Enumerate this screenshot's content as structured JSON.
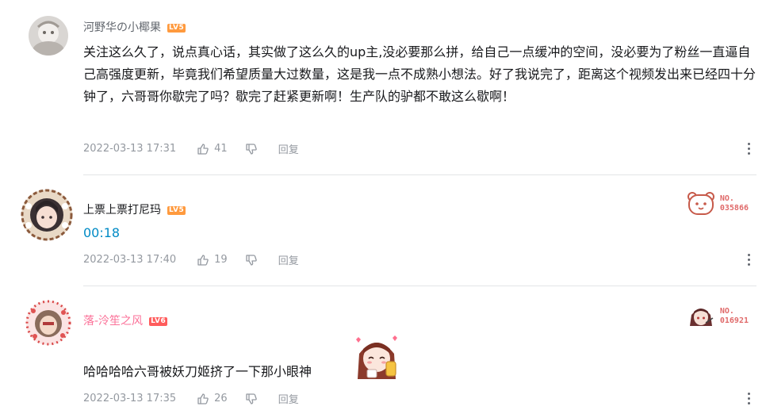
{
  "comments": [
    {
      "username": "河野华の小椰果",
      "level": "LV5",
      "content": "关注这么久了，说点真心话，其实做了这么久的up主,没必要那么拼，给自己一点缓冲的空间，没必要为了粉丝一直逼自己高强度更新，毕竟我们希望质量大过数量，这是我一点不成熟小想法。好了我说完了，距离这个视频发出来已经四十分钟了，六哥哥你歇完了吗？歇完了赶紧更新啊！生产队的驴都不敢这么歇啊！",
      "date": "2022-03-13 17:31",
      "likes": "41",
      "reply_label": "回复"
    },
    {
      "username": "上票上票打尼玛",
      "level": "LV5",
      "content": "00:18",
      "date": "2022-03-13 17:40",
      "likes": "19",
      "reply_label": "回复",
      "badge_label": "NO.",
      "badge_number": "035866"
    },
    {
      "username": "落-泠笙之风",
      "level": "LV6",
      "content": "哈哈哈哈六哥被妖刀姬挤了一下那小眼神",
      "date": "2022-03-13 17:35",
      "likes": "26",
      "reply_label": "回复",
      "badge_label": "NO.",
      "badge_number": "016921"
    }
  ],
  "colors": {
    "username_gray": "#61666d",
    "username_pink": "#fb7299",
    "timestamp_link": "#008ac5",
    "meta_gray": "#9499a0",
    "level_orange": "#ff9a3e",
    "level_red": "#ff5c5c"
  },
  "icons": {
    "like": "thumbs-up-icon",
    "dislike": "thumbs-down-icon",
    "more": "more-vertical-icon"
  }
}
